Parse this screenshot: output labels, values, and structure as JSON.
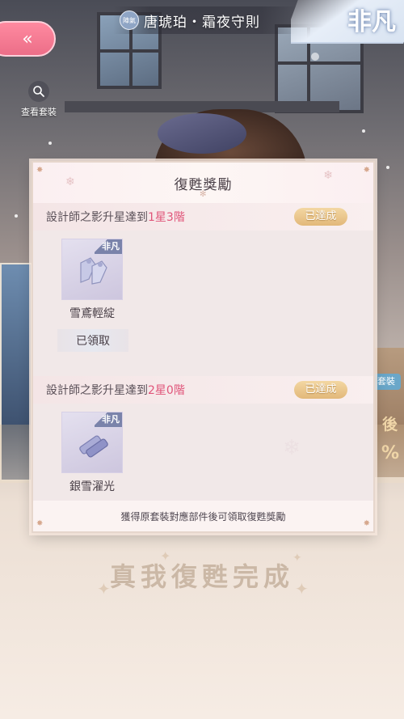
{
  "header": {
    "badge": "陣氣",
    "title": "唐琥珀・霜夜守則",
    "rarity": "非凡"
  },
  "back_icon": "double-chevron-left-icon",
  "view_outfit": {
    "label": "查看套裝",
    "icon": "search-icon"
  },
  "dialog": {
    "title": "復甦獎勵",
    "sections": [
      {
        "requirement_prefix": "設計師之影升星達到",
        "requirement_highlight": "1星3階",
        "status": "已達成",
        "item": {
          "name": "雪鳶輕綻",
          "tag": "非凡",
          "icon": "gloves-icon"
        },
        "claim_status": "已領取"
      },
      {
        "requirement_prefix": "設計師之影升星達到",
        "requirement_highlight": "2星0階",
        "status": "已達成",
        "item": {
          "name": "銀雪濯光",
          "tag": "非凡",
          "icon": "silver-bars-icon"
        }
      }
    ],
    "footer": "獲得原套裝對應部件後可領取復甦獎勵"
  },
  "completion_text": "真我復甦完成",
  "background_text": {
    "tag": "套裝",
    "glyph_1": "後",
    "glyph_2": "%"
  },
  "colors": {
    "accent_pink": "#e0557a",
    "achieved_gold": "#e2b879",
    "back_button": "#ec6e88"
  }
}
